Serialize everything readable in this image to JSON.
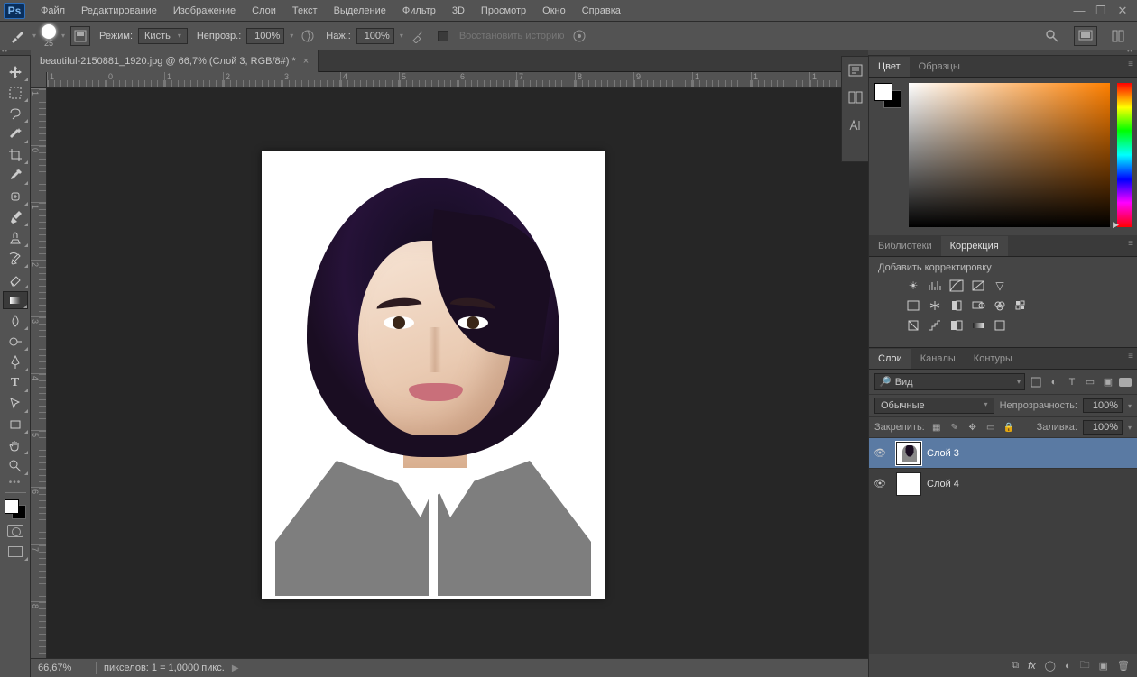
{
  "menu": {
    "items": [
      "Файл",
      "Редактирование",
      "Изображение",
      "Слои",
      "Текст",
      "Выделение",
      "Фильтр",
      "3D",
      "Просмотр",
      "Окно",
      "Справка"
    ]
  },
  "options_bar": {
    "brush_size": "25",
    "mode_label": "Режим:",
    "mode_value": "Кисть",
    "opacity_label": "Непрозр.:",
    "opacity_value": "100%",
    "flow_label": "Наж.:",
    "flow_value": "100%",
    "history_label": "Восстановить историю"
  },
  "document": {
    "tab_title": "beautiful-2150881_1920.jpg @ 66,7% (Слой 3, RGB/8#) *"
  },
  "ruler_h_ticks": [
    "1",
    "0",
    "1",
    "2",
    "3",
    "4",
    "5",
    "6",
    "7",
    "8",
    "9",
    "1",
    "1",
    "1"
  ],
  "ruler_v_ticks": [
    "1",
    "0",
    "1",
    "2",
    "3",
    "4",
    "5",
    "6",
    "7",
    "8"
  ],
  "status": {
    "zoom": "66,67%",
    "info": "пикселов: 1 = 1,0000 пикс."
  },
  "panels": {
    "color": {
      "tabs": [
        "Цвет",
        "Образцы"
      ],
      "active": 0
    },
    "lib_corr": {
      "tabs": [
        "Библиотеки",
        "Коррекция"
      ],
      "active": 1,
      "add_label": "Добавить корректировку"
    },
    "layers": {
      "tabs": [
        "Слои",
        "Каналы",
        "Контуры"
      ],
      "active": 0,
      "filter_label": "Вид",
      "blend_mode": "Обычные",
      "opacity_label": "Непрозрачность:",
      "opacity_value": "100%",
      "lock_label": "Закрепить:",
      "fill_label": "Заливка:",
      "fill_value": "100%",
      "items": [
        {
          "name": "Слой 3",
          "selected": true,
          "thumb": "person"
        },
        {
          "name": "Слой 4",
          "selected": false,
          "thumb": "white"
        }
      ]
    }
  }
}
